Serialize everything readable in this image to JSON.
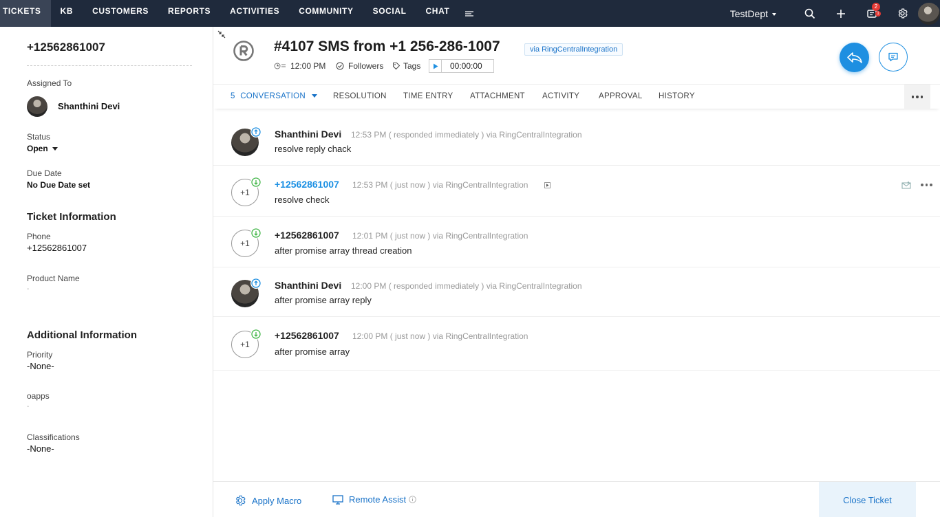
{
  "nav": {
    "items": [
      "TICKETS",
      "KB",
      "CUSTOMERS",
      "REPORTS",
      "ACTIVITIES",
      "COMMUNITY",
      "SOCIAL",
      "CHAT"
    ],
    "department": "TestDept",
    "notification_count": "2",
    "notification_sub_count": "1"
  },
  "left": {
    "contact_phone": "+12562861007",
    "assigned_to_label": "Assigned To",
    "assignee": "Shanthini Devi",
    "status_label": "Status",
    "status": "Open",
    "due_date_label": "Due Date",
    "due_date": "No Due Date set",
    "ticket_info_heading": "Ticket Information",
    "phone_label": "Phone",
    "phone": "+12562861007",
    "product_name_label": "Product Name",
    "product_name": "-",
    "additional_heading": "Additional Information",
    "priority_label": "Priority",
    "priority": "-None-",
    "oapps_label": "oapps",
    "oapps": "-",
    "classifications_label": "Classifications",
    "classifications": "-None-"
  },
  "ticket": {
    "title": "#4107  SMS from +1 256-286-1007",
    "via": "via RingCentralIntegration",
    "time": "12:00 PM",
    "followers": "Followers",
    "tags": "Tags",
    "timer": "00:00:00"
  },
  "tabs": {
    "conversation_count": "5",
    "conversation": "CONVERSATION",
    "resolution": "RESOLUTION",
    "time_entry": "TIME ENTRY",
    "attachment": "ATTACHMENT",
    "activity": "ACTIVITY",
    "approval": "APPROVAL",
    "history": "HISTORY"
  },
  "threads": [
    {
      "author": "Shanthini Devi",
      "meta": "12:53 PM ( responded immediately )  via RingCentralIntegration",
      "message": "resolve reply chack",
      "direction": "outgoing"
    },
    {
      "author": "+12562861007",
      "meta": "12:53 PM ( just now )  via RingCentralIntegration",
      "message": "resolve check",
      "direction": "incoming",
      "initial": "+1"
    },
    {
      "author": "+12562861007",
      "meta": "12:01 PM ( just now )  via RingCentralIntegration",
      "message": "after promise array thread creation",
      "direction": "incoming",
      "initial": "+1"
    },
    {
      "author": "Shanthini Devi",
      "meta": "12:00 PM ( responded immediately )  via RingCentralIntegration",
      "message": "after promise array reply",
      "direction": "outgoing"
    },
    {
      "author": "+12562861007",
      "meta": "12:00 PM ( just now )  via RingCentralIntegration",
      "message": "after promise array",
      "direction": "incoming",
      "initial": "+1"
    }
  ],
  "footer": {
    "apply_macro": "Apply Macro",
    "remote_assist": "Remote Assist",
    "close_ticket": "Close Ticket"
  },
  "colors": {
    "nav_bg": "#1f2a3c",
    "accent": "#1a73c8",
    "reply_button": "#1e8fe1",
    "incoming_badge": "#43b649"
  }
}
